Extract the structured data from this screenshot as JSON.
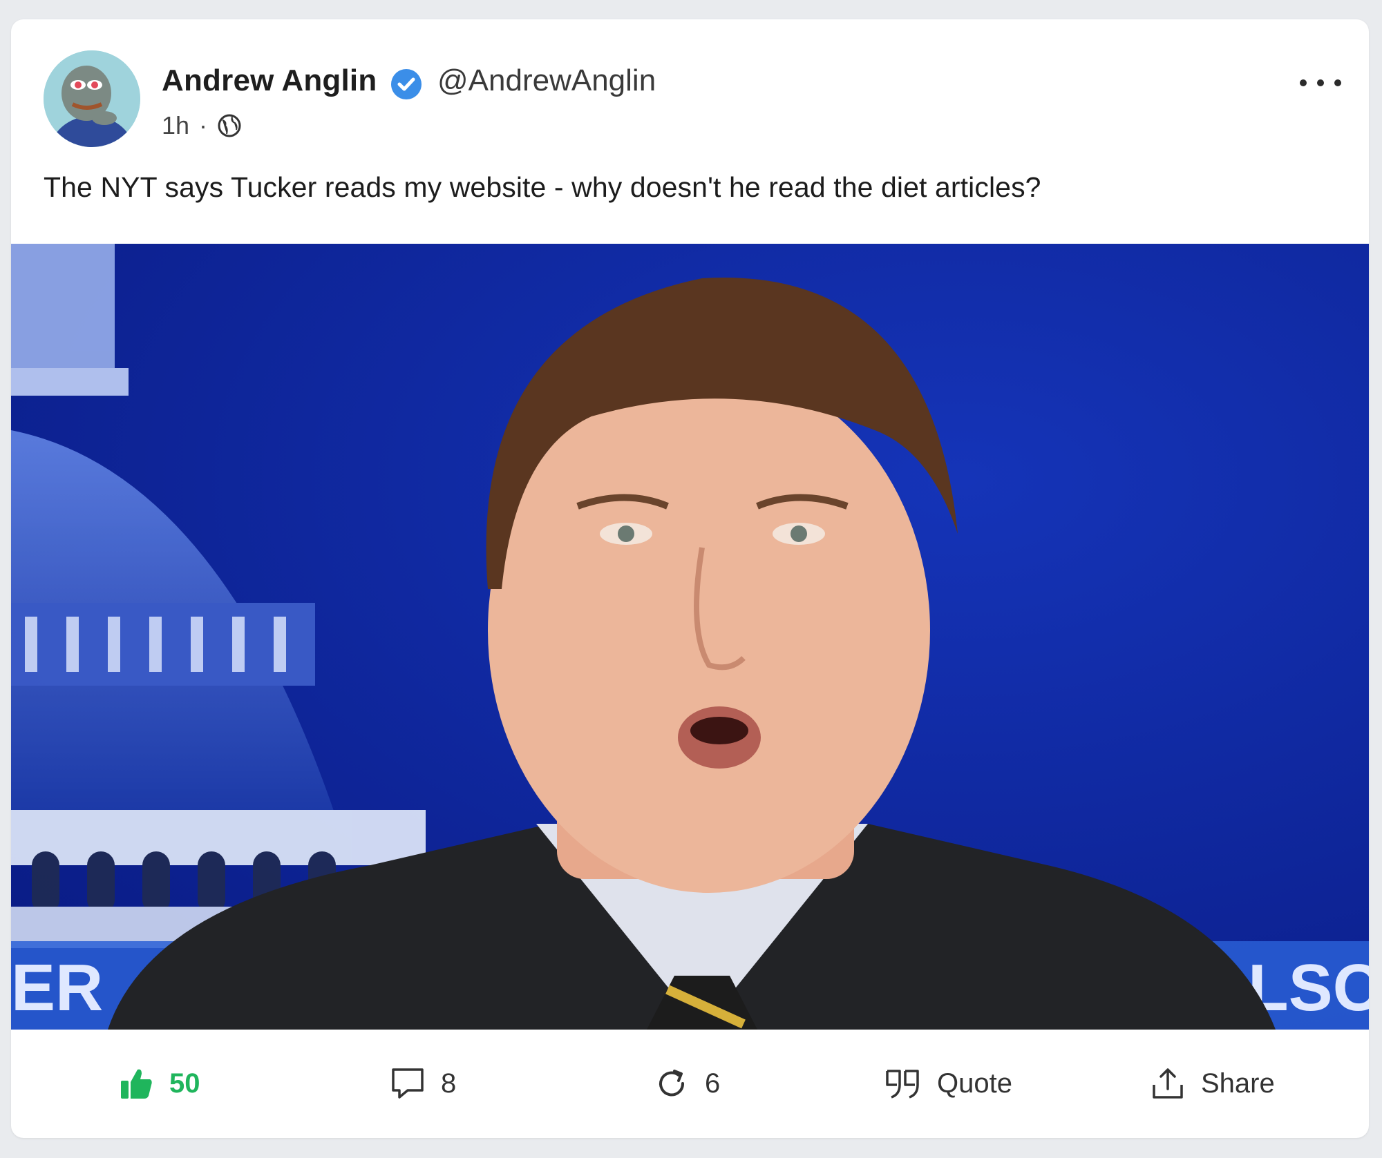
{
  "post": {
    "author_name": "Andrew Anglin",
    "author_handle": "@AndrewAnglin",
    "time": "1h",
    "separator": "·",
    "visibility_icon": "globe-icon",
    "text": "The NYT says Tucker reads my website - why doesn't he read the diet articles?",
    "media": {
      "caption_left": "ER",
      "caption_right": "LSO"
    }
  },
  "actions": {
    "like_count": "50",
    "comment_count": "8",
    "repost_count": "6",
    "quote_label": "Quote",
    "share_label": "Share"
  },
  "colors": {
    "like_green": "#1fb55c",
    "verified_blue": "#3b8ee8",
    "media_background": "#0b1f8a"
  }
}
